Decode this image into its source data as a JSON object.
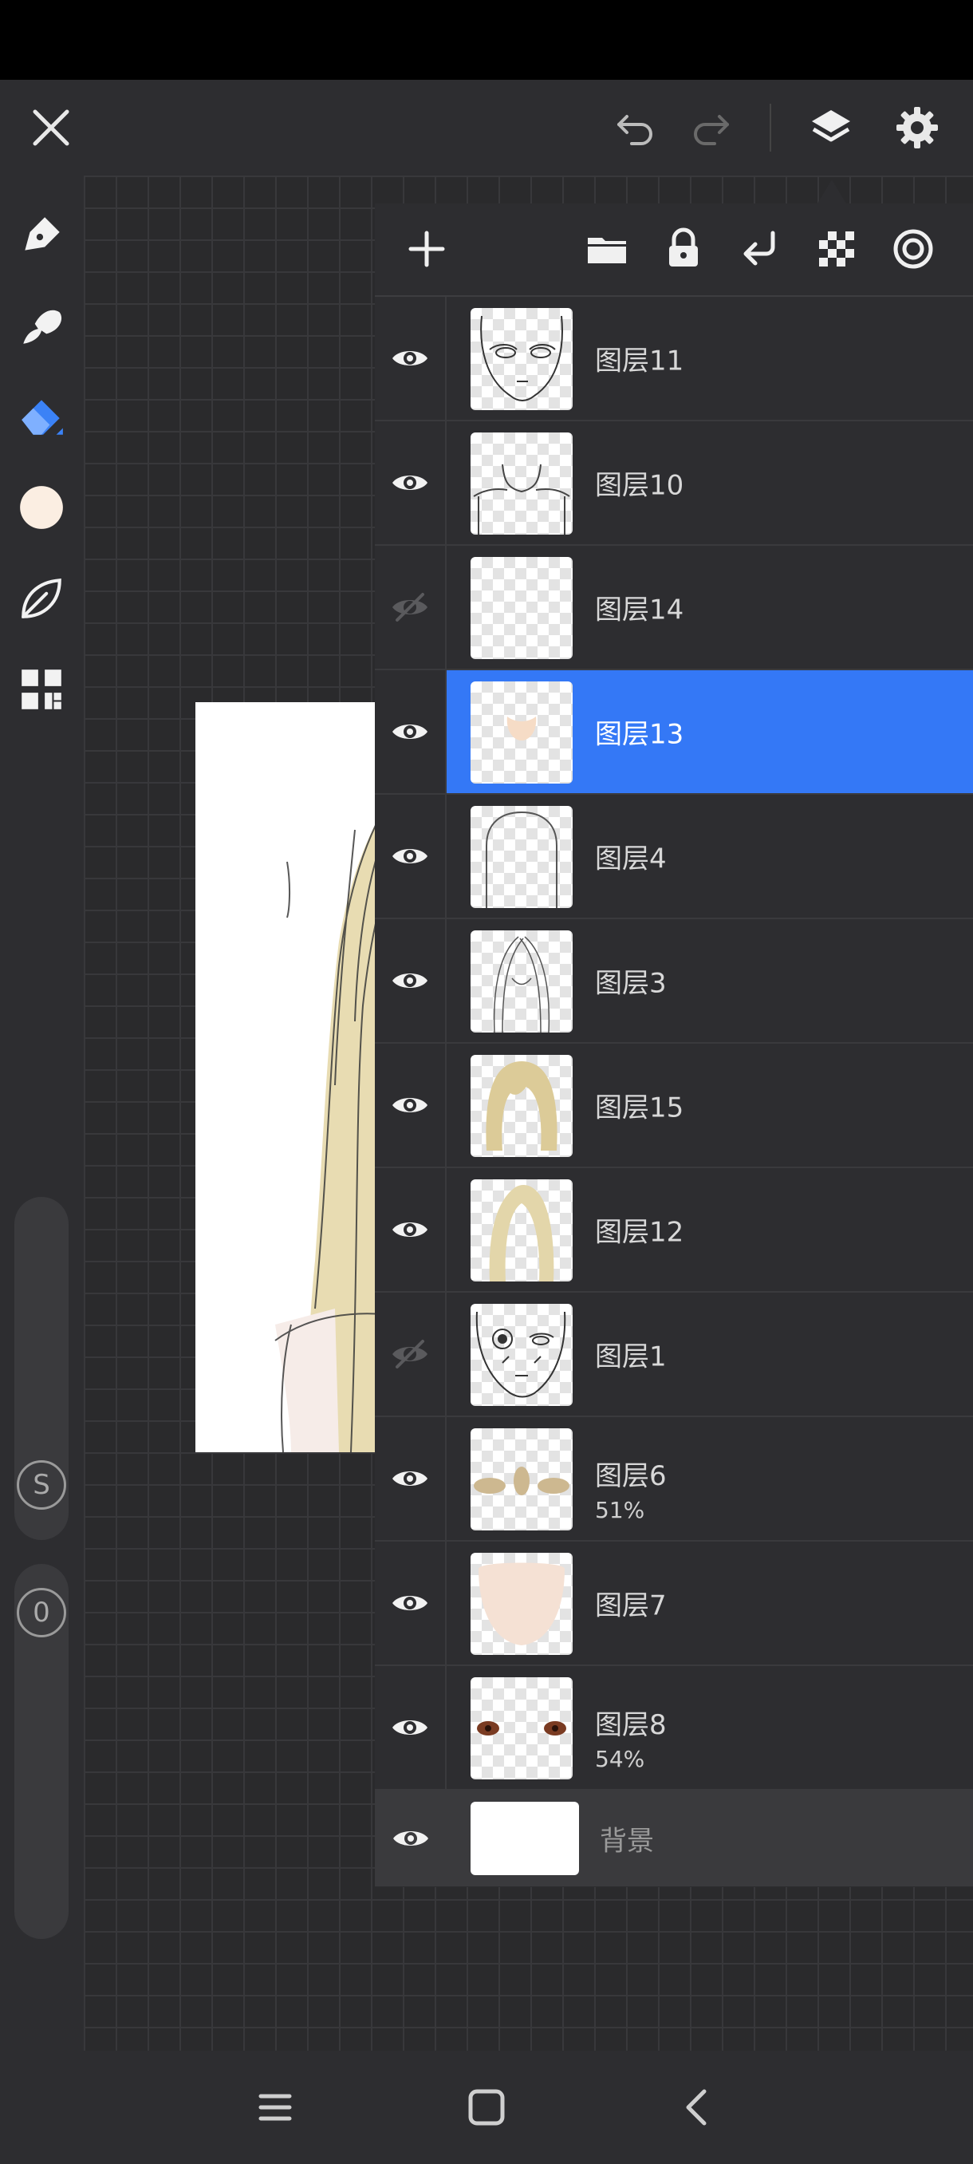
{
  "topbar": {
    "close_icon": "close-icon",
    "undo_icon": "undo-icon",
    "redo_icon": "redo-icon",
    "layers_icon": "layers-icon",
    "settings_icon": "gear-icon"
  },
  "left_toolbar": {
    "tools": [
      "pen-icon",
      "smudge-icon",
      "eraser-icon",
      "color-swatch",
      "leaf-icon",
      "grid-menu-icon"
    ],
    "active_tool": "eraser",
    "current_color": "#fbeee2",
    "size_slider_label": "S",
    "opacity_slider_label": "0"
  },
  "layers_panel": {
    "header_icons": [
      "add-icon",
      "folder-icon",
      "lock-icon",
      "merge-down-icon",
      "transparency-icon",
      "target-icon"
    ],
    "selected_color": "#3478f6",
    "layers": [
      {
        "name": "图层11",
        "visible": true,
        "opacity": ""
      },
      {
        "name": "图层10",
        "visible": true,
        "opacity": ""
      },
      {
        "name": "图层14",
        "visible": false,
        "opacity": ""
      },
      {
        "name": "图层13",
        "visible": true,
        "opacity": "",
        "selected": true
      },
      {
        "name": "图层4",
        "visible": true,
        "opacity": ""
      },
      {
        "name": "图层3",
        "visible": true,
        "opacity": ""
      },
      {
        "name": "图层15",
        "visible": true,
        "opacity": ""
      },
      {
        "name": "图层12",
        "visible": true,
        "opacity": ""
      },
      {
        "name": "图层1",
        "visible": false,
        "opacity": ""
      },
      {
        "name": "图层6",
        "visible": true,
        "opacity": "51%"
      },
      {
        "name": "图层7",
        "visible": true,
        "opacity": ""
      },
      {
        "name": "图层8",
        "visible": true,
        "opacity": "54%"
      }
    ],
    "background_layer": {
      "name": "背景",
      "visible": true
    }
  },
  "bottom_nav": {
    "buttons": [
      "recents-icon",
      "home-icon",
      "back-icon"
    ]
  }
}
